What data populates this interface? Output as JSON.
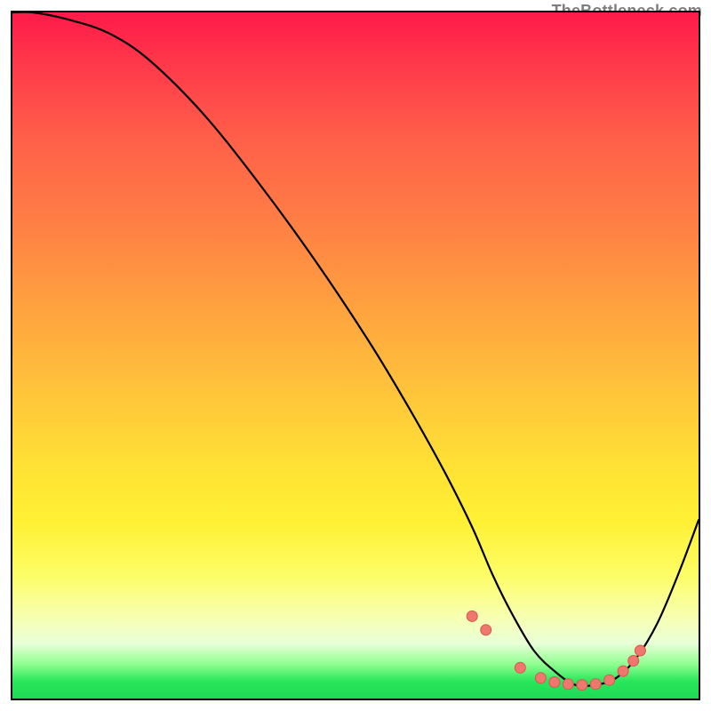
{
  "watermark": "TheBottleneck.com",
  "chart_data": {
    "type": "line",
    "title": "",
    "xlabel": "",
    "ylabel": "",
    "xlim": [
      0,
      100
    ],
    "ylim": [
      0,
      100
    ],
    "series": [
      {
        "name": "bottleneck-curve",
        "x": [
          0,
          3,
          8,
          14,
          20,
          28,
          36,
          44,
          52,
          58,
          63,
          67,
          70,
          73,
          76,
          79,
          82,
          85,
          88,
          91,
          94,
          97,
          100
        ],
        "y": [
          100,
          100,
          99,
          97,
          93,
          85,
          75,
          64,
          52,
          42,
          33,
          25,
          18,
          12,
          7,
          4,
          2,
          2,
          3,
          6,
          11,
          18,
          26
        ]
      }
    ],
    "markers": {
      "name": "highlight-dots",
      "x": [
        67,
        69,
        74,
        77,
        79,
        81,
        83,
        85,
        87,
        89,
        90.5,
        91.5
      ],
      "y": [
        12,
        10,
        4.5,
        3,
        2.4,
        2.1,
        2.0,
        2.1,
        2.7,
        4.0,
        5.5,
        7.0
      ]
    }
  }
}
